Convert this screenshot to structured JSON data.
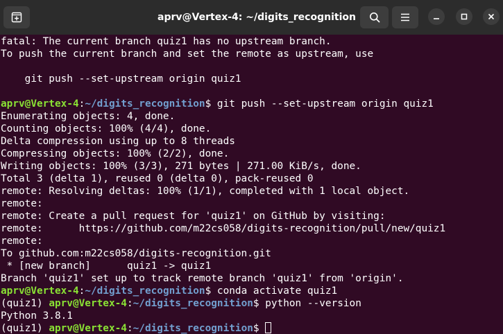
{
  "window": {
    "title": "aprv@Vertex-4: ~/digits_recognition",
    "icons": {
      "new_tab": "new-tab-icon",
      "search": "search-icon",
      "menu": "hamburger-menu-icon",
      "minimize": "minimize-icon",
      "maximize": "maximize-icon",
      "close": "close-icon"
    }
  },
  "colors": {
    "background": "#300a24",
    "titlebar": "#2c2c2c",
    "user_host": "#8ae234",
    "path": "#729fcf",
    "text": "#ffffff"
  },
  "terminal": {
    "prompt": {
      "user_host": "aprv@Vertex-4",
      "colon": ":",
      "path": "~/digits_recognition",
      "symbol": "$ ",
      "env": "(quiz1) "
    },
    "lines": [
      "fatal: The current branch quiz1 has no upstream branch.",
      "To push the current branch and set the remote as upstream, use",
      "",
      "    git push --set-upstream origin quiz1",
      "",
      "Enumerating objects: 4, done.",
      "Counting objects: 100% (4/4), done.",
      "Delta compression using up to 8 threads",
      "Compressing objects: 100% (2/2), done.",
      "Writing objects: 100% (3/3), 271 bytes | 271.00 KiB/s, done.",
      "Total 3 (delta 1), reused 0 (delta 0), pack-reused 0",
      "remote: Resolving deltas: 100% (1/1), completed with 1 local object.",
      "remote:",
      "remote: Create a pull request for 'quiz1' on GitHub by visiting:",
      "remote:      https://github.com/m22cs058/digits-recognition/pull/new/quiz1",
      "remote:",
      "To github.com:m22cs058/digits-recognition.git",
      " * [new branch]      quiz1 -> quiz1",
      "Branch 'quiz1' set up to track remote branch 'quiz1' from 'origin'.",
      "Python 3.8.1"
    ],
    "commands": {
      "push": "git push --set-upstream origin quiz1",
      "activate": "conda activate quiz1",
      "version": "python --version",
      "current": ""
    }
  }
}
